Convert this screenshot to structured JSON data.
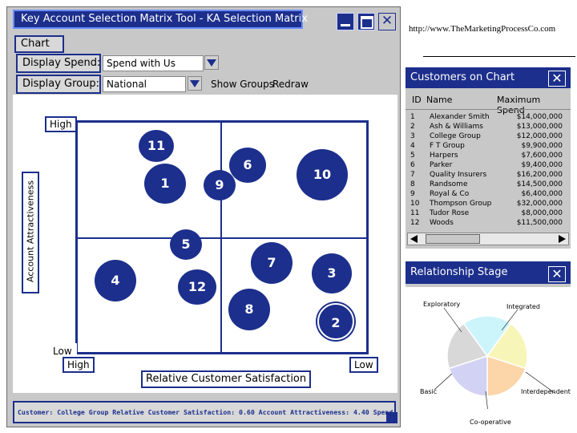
{
  "window": {
    "title": "Key Account Selection Matrix Tool - KA Selection Matrix"
  },
  "menu": {
    "chart_label": "Chart"
  },
  "controls": {
    "spend_label": "Display Spend:",
    "spend_value": "Spend with Us",
    "group_label": "Display Group:",
    "group_value": "National",
    "show_groups": "Show Groups",
    "redraw": "Redraw"
  },
  "matrix": {
    "y_axis_label": "Account Attractiveness",
    "x_axis_label": "Relative Customer Satisfaction",
    "y_high": "High",
    "y_low": "Low",
    "x_high": "High",
    "x_low": "Low",
    "bubbles": [
      {
        "id": "11",
        "label": "11"
      },
      {
        "id": "1",
        "label": "1"
      },
      {
        "id": "6",
        "label": "6"
      },
      {
        "id": "9",
        "label": "9"
      },
      {
        "id": "10",
        "label": "10"
      },
      {
        "id": "5",
        "label": "5"
      },
      {
        "id": "7",
        "label": "7"
      },
      {
        "id": "4",
        "label": "4"
      },
      {
        "id": "12",
        "label": "12"
      },
      {
        "id": "3",
        "label": "3"
      },
      {
        "id": "8",
        "label": "8"
      },
      {
        "id": "2",
        "label": "2"
      }
    ]
  },
  "status": {
    "text": "Customer: College Group  Relative Customer Satisfaction: 0.60  Account Attractiveness: 4.40 Spend"
  },
  "url": "http://www.TheMarketingProcessCo.com",
  "customers_panel": {
    "title": "Customers on Chart",
    "col_id": "ID",
    "col_name": "Name",
    "col_spend": "Maximum Spend",
    "rows": [
      {
        "id": "1",
        "name": "Alexander Smith",
        "spend": "$14,000,000"
      },
      {
        "id": "2",
        "name": "Ash & Williams",
        "spend": "$13,000,000"
      },
      {
        "id": "3",
        "name": "College Group",
        "spend": "$12,000,000"
      },
      {
        "id": "4",
        "name": "F T Group",
        "spend": "$9,900,000"
      },
      {
        "id": "5",
        "name": "Harpers",
        "spend": "$7,600,000"
      },
      {
        "id": "6",
        "name": "Parker",
        "spend": "$9,400,000"
      },
      {
        "id": "7",
        "name": "Quality Insurers",
        "spend": "$16,200,000"
      },
      {
        "id": "8",
        "name": "Randsome",
        "spend": "$14,500,000"
      },
      {
        "id": "9",
        "name": "Royal & Co",
        "spend": "$6,400,000"
      },
      {
        "id": "10",
        "name": "Thompson Group",
        "spend": "$32,000,000"
      },
      {
        "id": "11",
        "name": "Tudor Rose",
        "spend": "$8,000,000"
      },
      {
        "id": "12",
        "name": "Woods",
        "spend": "$11,500,000"
      }
    ]
  },
  "relationship_panel": {
    "title": "Relationship Stage",
    "stages": [
      "Exploratory",
      "Integrated",
      "Interdependent",
      "Co-operative",
      "Basic"
    ],
    "colors": [
      "#ccf4fb",
      "#f8f5b8",
      "#fcd5a8",
      "#d2d2f4",
      "#d8d8d8"
    ]
  },
  "colors": {
    "accent": "#1c2f8c",
    "bubble": "#1c2f8c",
    "window_bg": "#c8c8c8"
  }
}
